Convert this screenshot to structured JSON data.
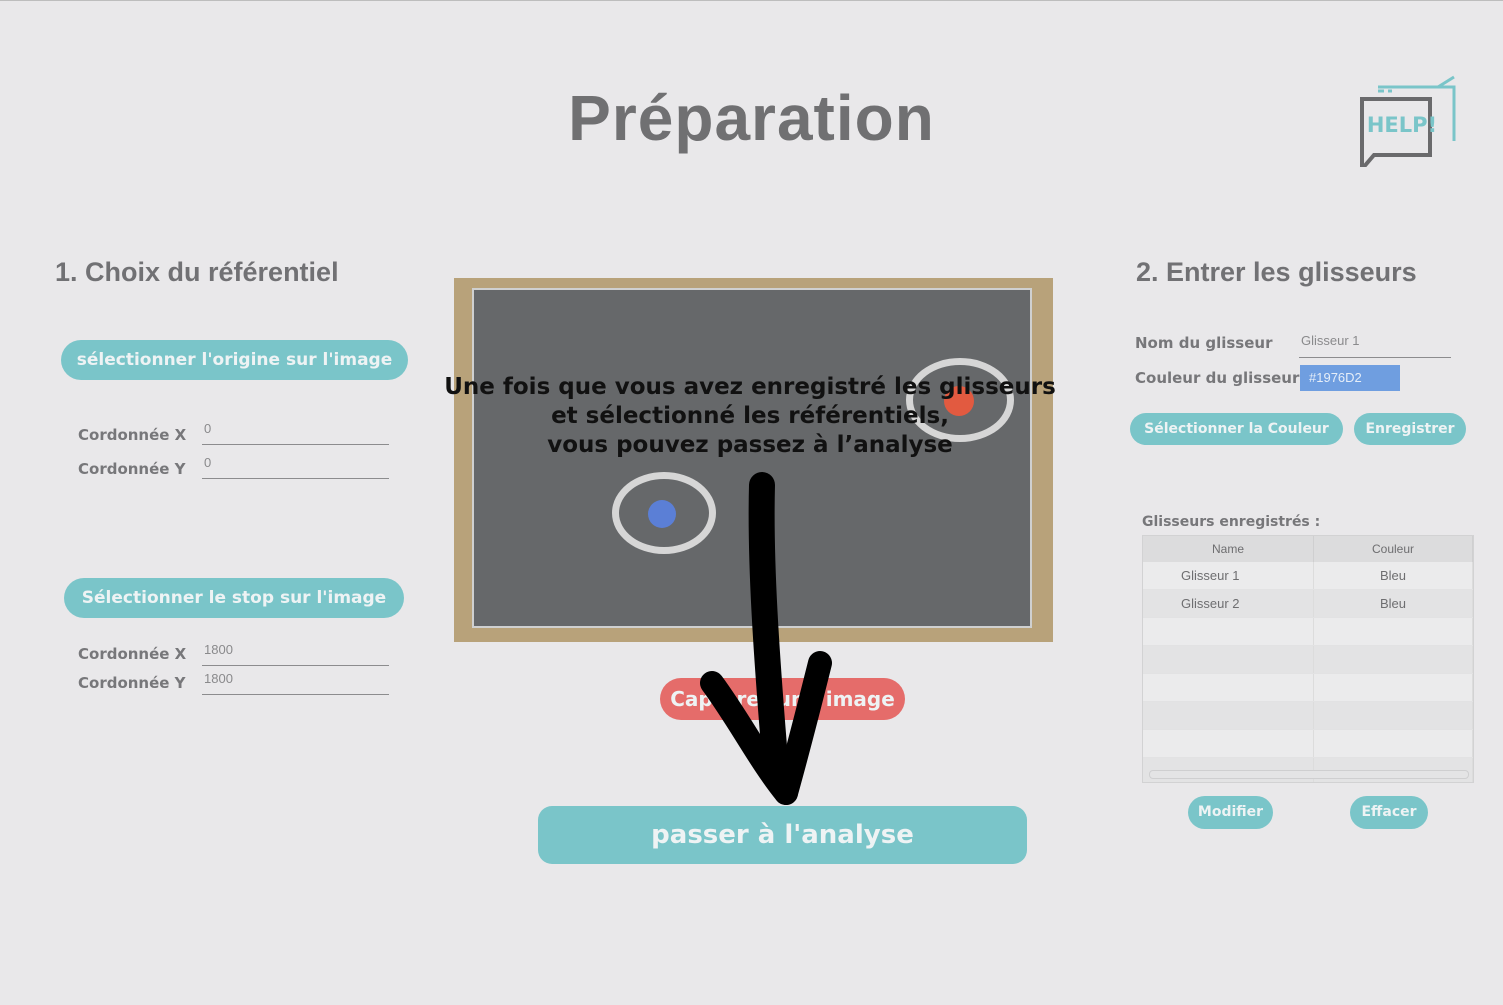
{
  "page": {
    "title": "Préparation"
  },
  "help": {
    "label": "HELP!"
  },
  "left": {
    "section_title": "1. Choix du référentiel",
    "origin_button": "sélectionner l'origine sur l'image",
    "origin": {
      "x_label": "Cordonnée X",
      "x_value": "0",
      "y_label": "Cordonnée Y",
      "y_value": "0"
    },
    "stop_button": "Sélectionner le stop sur l'image",
    "stop": {
      "x_label": "Cordonnée X",
      "x_value": "1800",
      "y_label": "Cordonnée Y",
      "y_value": "1800"
    }
  },
  "center": {
    "overlay_lines": [
      "Une fois que vous avez enregistré les glisseurs",
      "et sélectionné les référentiels,",
      "vous pouvez passez à l’analyse"
    ],
    "capture_button": "Capturer une image",
    "analyse_button": "passer à l'analyse"
  },
  "right": {
    "section_title": "2. Entrer les glisseurs",
    "name_label": "Nom du glisseur",
    "name_value": "Glisseur 1",
    "color_label": "Couleur du glisseur",
    "color_value": "#1976D2",
    "select_color_button": "Sélectionner la Couleur",
    "save_button": "Enregistrer",
    "table_title": "Glisseurs enregistrés :",
    "columns": [
      "Name",
      "Couleur"
    ],
    "rows": [
      {
        "name": "Glisseur 1",
        "color": "Bleu"
      },
      {
        "name": "Glisseur 2",
        "color": "Bleu"
      }
    ],
    "edit_button": "Modifier",
    "delete_button": "Effacer"
  },
  "colors": {
    "teal": "#7ac5c9",
    "red": "#e56c6a",
    "blue_puck": "#5b7fd6",
    "red_puck": "#e25a40"
  }
}
